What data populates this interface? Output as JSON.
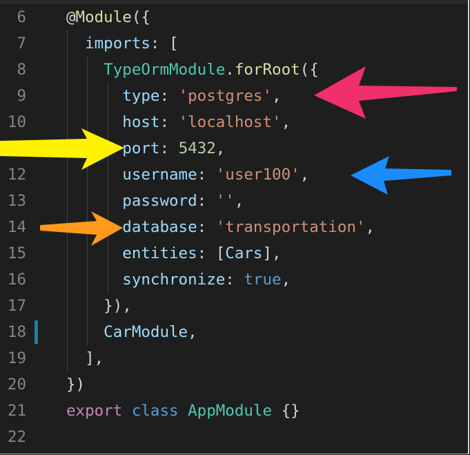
{
  "editor": {
    "line_numbers": [
      "6",
      "7",
      "8",
      "9",
      "10",
      "11",
      "12",
      "13",
      "14",
      "15",
      "16",
      "17",
      "18",
      "19",
      "20",
      "21",
      "22"
    ],
    "lines": [
      {
        "tokens": [
          {
            "text": "@",
            "cls": "t-plain"
          },
          {
            "text": "Module",
            "cls": "t-func"
          },
          {
            "text": "({",
            "cls": "t-punct"
          }
        ]
      },
      {
        "tokens": [
          {
            "text": "  imports",
            "cls": "t-prop"
          },
          {
            "text": ": [",
            "cls": "t-punct"
          }
        ]
      },
      {
        "tokens": [
          {
            "text": "    TypeOrmModule",
            "cls": "t-class"
          },
          {
            "text": ".",
            "cls": "t-punct"
          },
          {
            "text": "forRoot",
            "cls": "t-func"
          },
          {
            "text": "({",
            "cls": "t-punct"
          }
        ]
      },
      {
        "tokens": [
          {
            "text": "      type",
            "cls": "t-prop"
          },
          {
            "text": ": ",
            "cls": "t-punct"
          },
          {
            "text": "'postgres'",
            "cls": "t-string"
          },
          {
            "text": ",",
            "cls": "t-punct"
          }
        ]
      },
      {
        "tokens": [
          {
            "text": "      host",
            "cls": "t-prop"
          },
          {
            "text": ": ",
            "cls": "t-punct"
          },
          {
            "text": "'localhost'",
            "cls": "t-string"
          },
          {
            "text": ",",
            "cls": "t-punct"
          }
        ]
      },
      {
        "tokens": [
          {
            "text": "      port",
            "cls": "t-prop"
          },
          {
            "text": ": ",
            "cls": "t-punct"
          },
          {
            "text": "5432",
            "cls": "t-number"
          },
          {
            "text": ",",
            "cls": "t-punct"
          }
        ]
      },
      {
        "tokens": [
          {
            "text": "      username",
            "cls": "t-prop"
          },
          {
            "text": ": ",
            "cls": "t-punct"
          },
          {
            "text": "'user100'",
            "cls": "t-string"
          },
          {
            "text": ",",
            "cls": "t-punct"
          }
        ]
      },
      {
        "tokens": [
          {
            "text": "      password",
            "cls": "t-prop"
          },
          {
            "text": ": ",
            "cls": "t-punct"
          },
          {
            "text": "''",
            "cls": "t-string"
          },
          {
            "text": ",",
            "cls": "t-punct"
          }
        ]
      },
      {
        "tokens": [
          {
            "text": "      database",
            "cls": "t-prop"
          },
          {
            "text": ": ",
            "cls": "t-punct"
          },
          {
            "text": "'transportation'",
            "cls": "t-string"
          },
          {
            "text": ",",
            "cls": "t-punct"
          }
        ]
      },
      {
        "tokens": [
          {
            "text": "      entities",
            "cls": "t-prop"
          },
          {
            "text": ": [",
            "cls": "t-punct"
          },
          {
            "text": "Cars",
            "cls": "t-prop"
          },
          {
            "text": "],",
            "cls": "t-punct"
          }
        ]
      },
      {
        "tokens": [
          {
            "text": "      synchronize",
            "cls": "t-prop"
          },
          {
            "text": ": ",
            "cls": "t-punct"
          },
          {
            "text": "true",
            "cls": "t-bool"
          },
          {
            "text": ",",
            "cls": "t-punct"
          }
        ]
      },
      {
        "tokens": [
          {
            "text": "    }),",
            "cls": "t-punct"
          }
        ]
      },
      {
        "tokens": [
          {
            "text": "    CarModule",
            "cls": "t-prop"
          },
          {
            "text": ",",
            "cls": "t-punct"
          }
        ]
      },
      {
        "tokens": [
          {
            "text": "  ],",
            "cls": "t-punct"
          }
        ]
      },
      {
        "tokens": [
          {
            "text": "})",
            "cls": "t-punct"
          }
        ]
      },
      {
        "tokens": [
          {
            "text": "export",
            "cls": "t-keyword"
          },
          {
            "text": " ",
            "cls": "t-plain"
          },
          {
            "text": "class",
            "cls": "t-storage"
          },
          {
            "text": " ",
            "cls": "t-plain"
          },
          {
            "text": "AppModule",
            "cls": "t-class"
          },
          {
            "text": " {}",
            "cls": "t-punct"
          }
        ]
      },
      {
        "tokens": []
      }
    ],
    "modified_line": "18"
  },
  "annotations": {
    "arrows": [
      {
        "color": "#f0306a",
        "points_to": "type"
      },
      {
        "color": "#fff200",
        "points_to": "port"
      },
      {
        "color": "#1a8cff",
        "points_to": "username"
      },
      {
        "color": "#ff9a1a",
        "points_to": "database"
      }
    ]
  }
}
